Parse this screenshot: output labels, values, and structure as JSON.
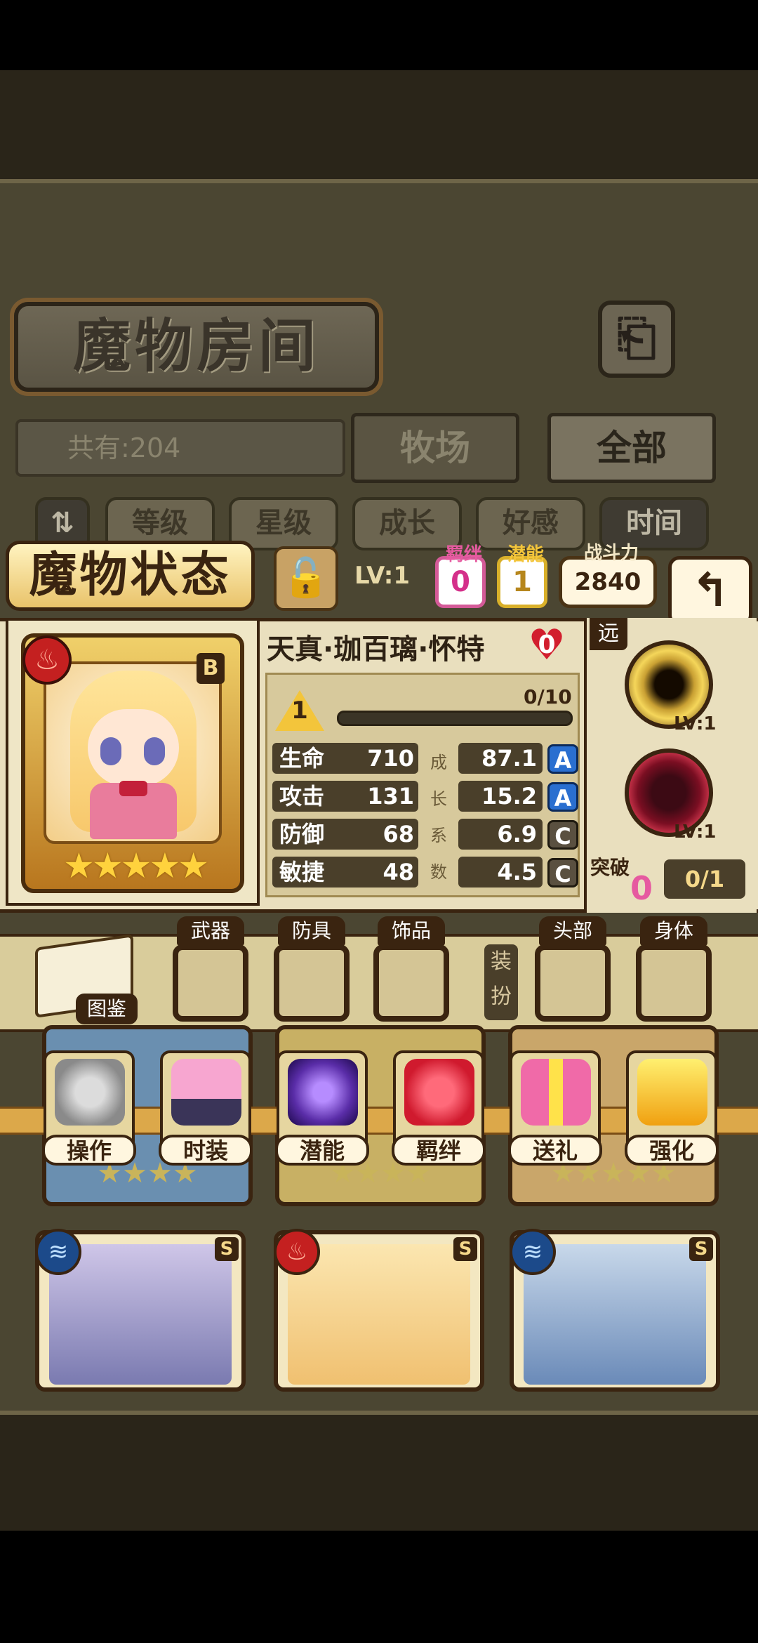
{
  "header": {
    "title": "魔物房间",
    "back_icon": "exit-door-icon"
  },
  "collection": {
    "count_label": "共有:204"
  },
  "tabs": [
    {
      "label": "牧场",
      "active": false
    },
    {
      "label": "全部",
      "active": true
    }
  ],
  "sort": {
    "toggle_icon": "order-toggle-icon",
    "items": [
      "等级",
      "星级",
      "成长",
      "好感",
      "时间"
    ],
    "active_index": 4
  },
  "status": {
    "title": "魔物状态",
    "lock_icon": "padlock-icon",
    "level_label": "LV:1",
    "bond": {
      "label": "羁绊",
      "value": "0"
    },
    "potential": {
      "label": "潜能",
      "value": "1"
    },
    "power": {
      "label": "战斗力",
      "value": "2840"
    },
    "return_icon": "return-arrow-icon"
  },
  "monster": {
    "name": "天真·珈百璃·怀特",
    "affection": "0",
    "rank": "B",
    "element": "fire",
    "stars": "★★★★★",
    "star_count": 5,
    "level": "1",
    "exp": "0/10",
    "exp_progress": 0
  },
  "stats": [
    {
      "label": "生命",
      "value": "710",
      "growth": "87.1",
      "grade": "A"
    },
    {
      "label": "攻击",
      "value": "131",
      "growth": "15.2",
      "grade": "A"
    },
    {
      "label": "防御",
      "value": "68",
      "growth": "6.9",
      "grade": "C"
    },
    {
      "label": "敏捷",
      "value": "48",
      "growth": "4.5",
      "grade": "C"
    }
  ],
  "growth_label": [
    "成",
    "长",
    "系",
    "数"
  ],
  "skills": {
    "range": "远",
    "items": [
      {
        "level": "LV:1",
        "icon": "dark-vortex-skill-icon"
      },
      {
        "level": "LV:1",
        "icon": "heartbeat-skill-icon"
      }
    ],
    "breakthrough": {
      "label": "突破",
      "count": "0",
      "progress": "0/1"
    }
  },
  "equipment": {
    "codex_label": "图鉴",
    "slots": [
      "武器",
      "防具",
      "饰品",
      "头部",
      "身体"
    ],
    "dress_label": "装扮"
  },
  "actions": [
    {
      "label": "操作",
      "icon": "gears-icon"
    },
    {
      "label": "时装",
      "icon": "outfit-icon"
    },
    {
      "label": "潜能",
      "icon": "demon-icon"
    },
    {
      "label": "羁绊",
      "icon": "hearts-icon"
    },
    {
      "label": "送礼",
      "icon": "gift-icon"
    },
    {
      "label": "强化",
      "icon": "upgrade-arrows-icon"
    }
  ],
  "cards_bottom": [
    {
      "element": "water",
      "rank": "S"
    },
    {
      "element": "fire",
      "rank": "S"
    },
    {
      "element": "water",
      "rank": "S"
    }
  ]
}
